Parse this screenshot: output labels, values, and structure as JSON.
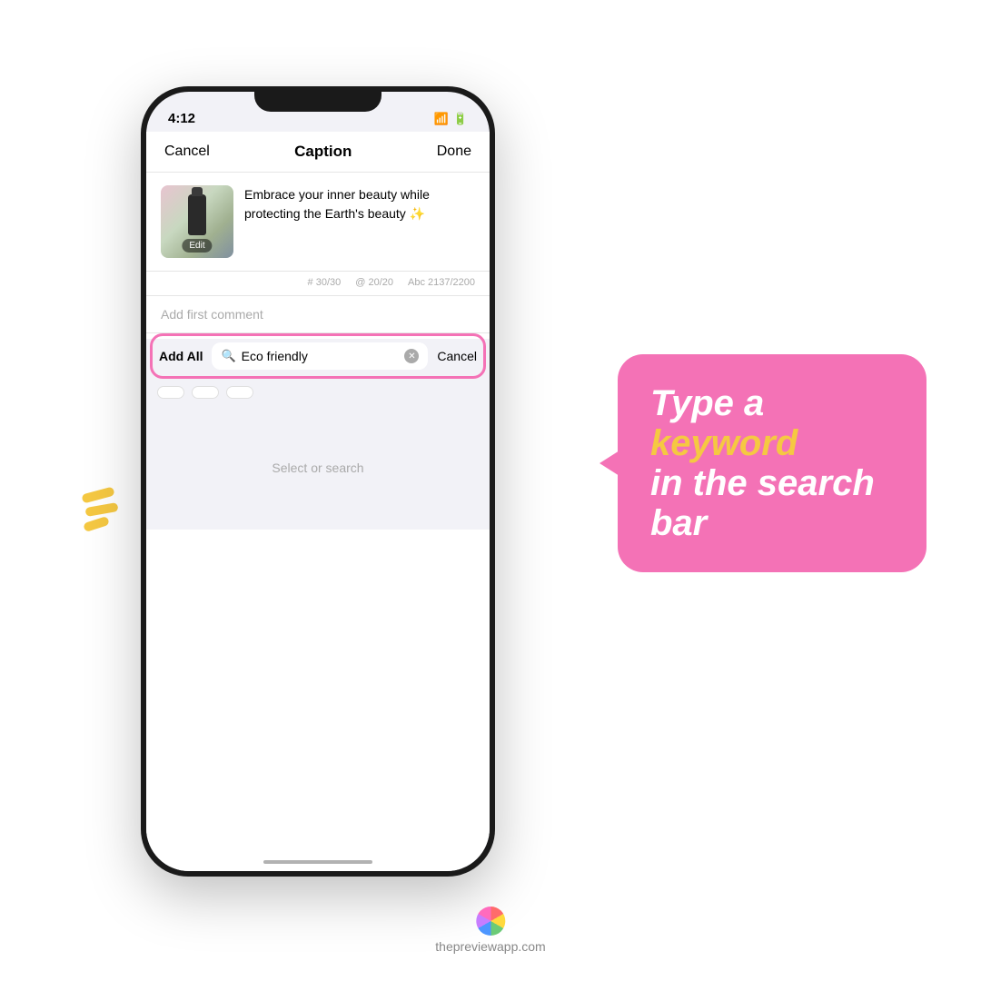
{
  "page": {
    "background": "#ffffff"
  },
  "status_bar": {
    "time": "4:12",
    "wifi_icon": "wifi",
    "battery_icon": "battery"
  },
  "nav": {
    "cancel_label": "Cancel",
    "title": "Caption",
    "done_label": "Done"
  },
  "caption": {
    "text": "Embrace your inner beauty while protecting the Earth's beauty ✨",
    "edit_label": "Edit"
  },
  "stats": {
    "hashtag_count": "# 30/30",
    "mention_count": "@ 20/20",
    "char_count": "Abc 2137/2200"
  },
  "add_comment": {
    "placeholder": "Add first comment"
  },
  "search_bar": {
    "add_all_label": "Add All",
    "search_value": "Eco friendly",
    "cancel_label": "Cancel"
  },
  "chips": {
    "items": [
      "",
      "",
      ""
    ]
  },
  "empty_state": {
    "text": "Select or search"
  },
  "speech_bubble": {
    "line1": "Type  a",
    "line2": "keyword",
    "line3": "in the search bar"
  },
  "footer": {
    "url": "thepreviewapp.com"
  }
}
